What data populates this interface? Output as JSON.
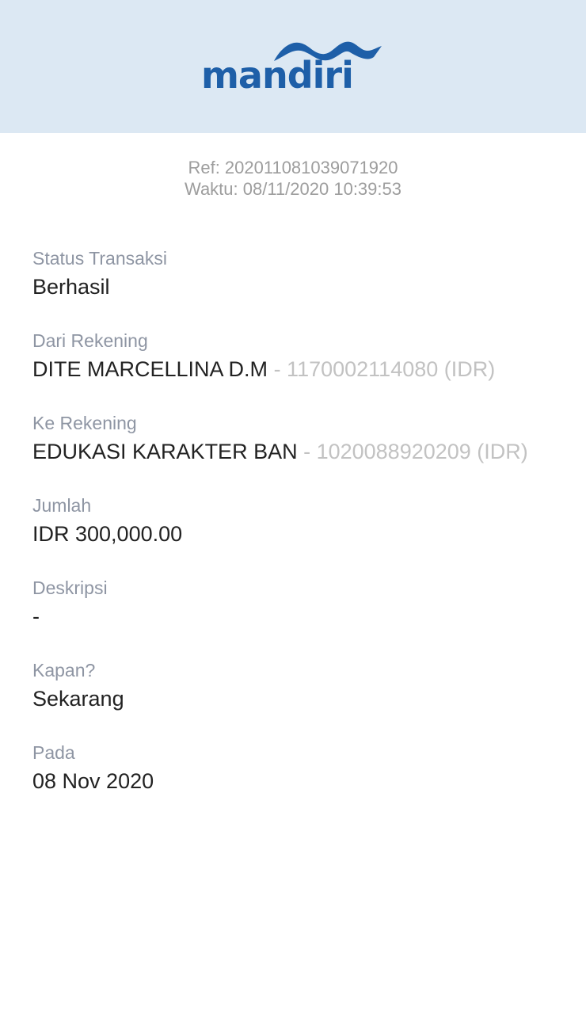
{
  "header": {
    "logo_text": "mandiri",
    "logo_icon": "wave-icon",
    "brand_color": "#1e5fa8",
    "background_color": "#dce8f3"
  },
  "meta": {
    "ref": "Ref: 202011081039071920",
    "time": "Waktu: 08/11/2020 10:39:53"
  },
  "fields": {
    "status": {
      "label": "Status Transaksi",
      "value": "Berhasil"
    },
    "from": {
      "label": "Dari Rekening",
      "name": "DITE MARCELLINA D.M",
      "account": " - 1170002114080 (IDR)"
    },
    "to": {
      "label": "Ke Rekening",
      "name": "EDUKASI KARAKTER BAN",
      "account": " - 1020088920209 (IDR)"
    },
    "amount": {
      "label": "Jumlah",
      "value": "IDR 300,000.00"
    },
    "description": {
      "label": "Deskripsi",
      "value": "-"
    },
    "when": {
      "label": "Kapan?",
      "value": "Sekarang"
    },
    "date": {
      "label": "Pada",
      "value": "08 Nov 2020"
    }
  }
}
